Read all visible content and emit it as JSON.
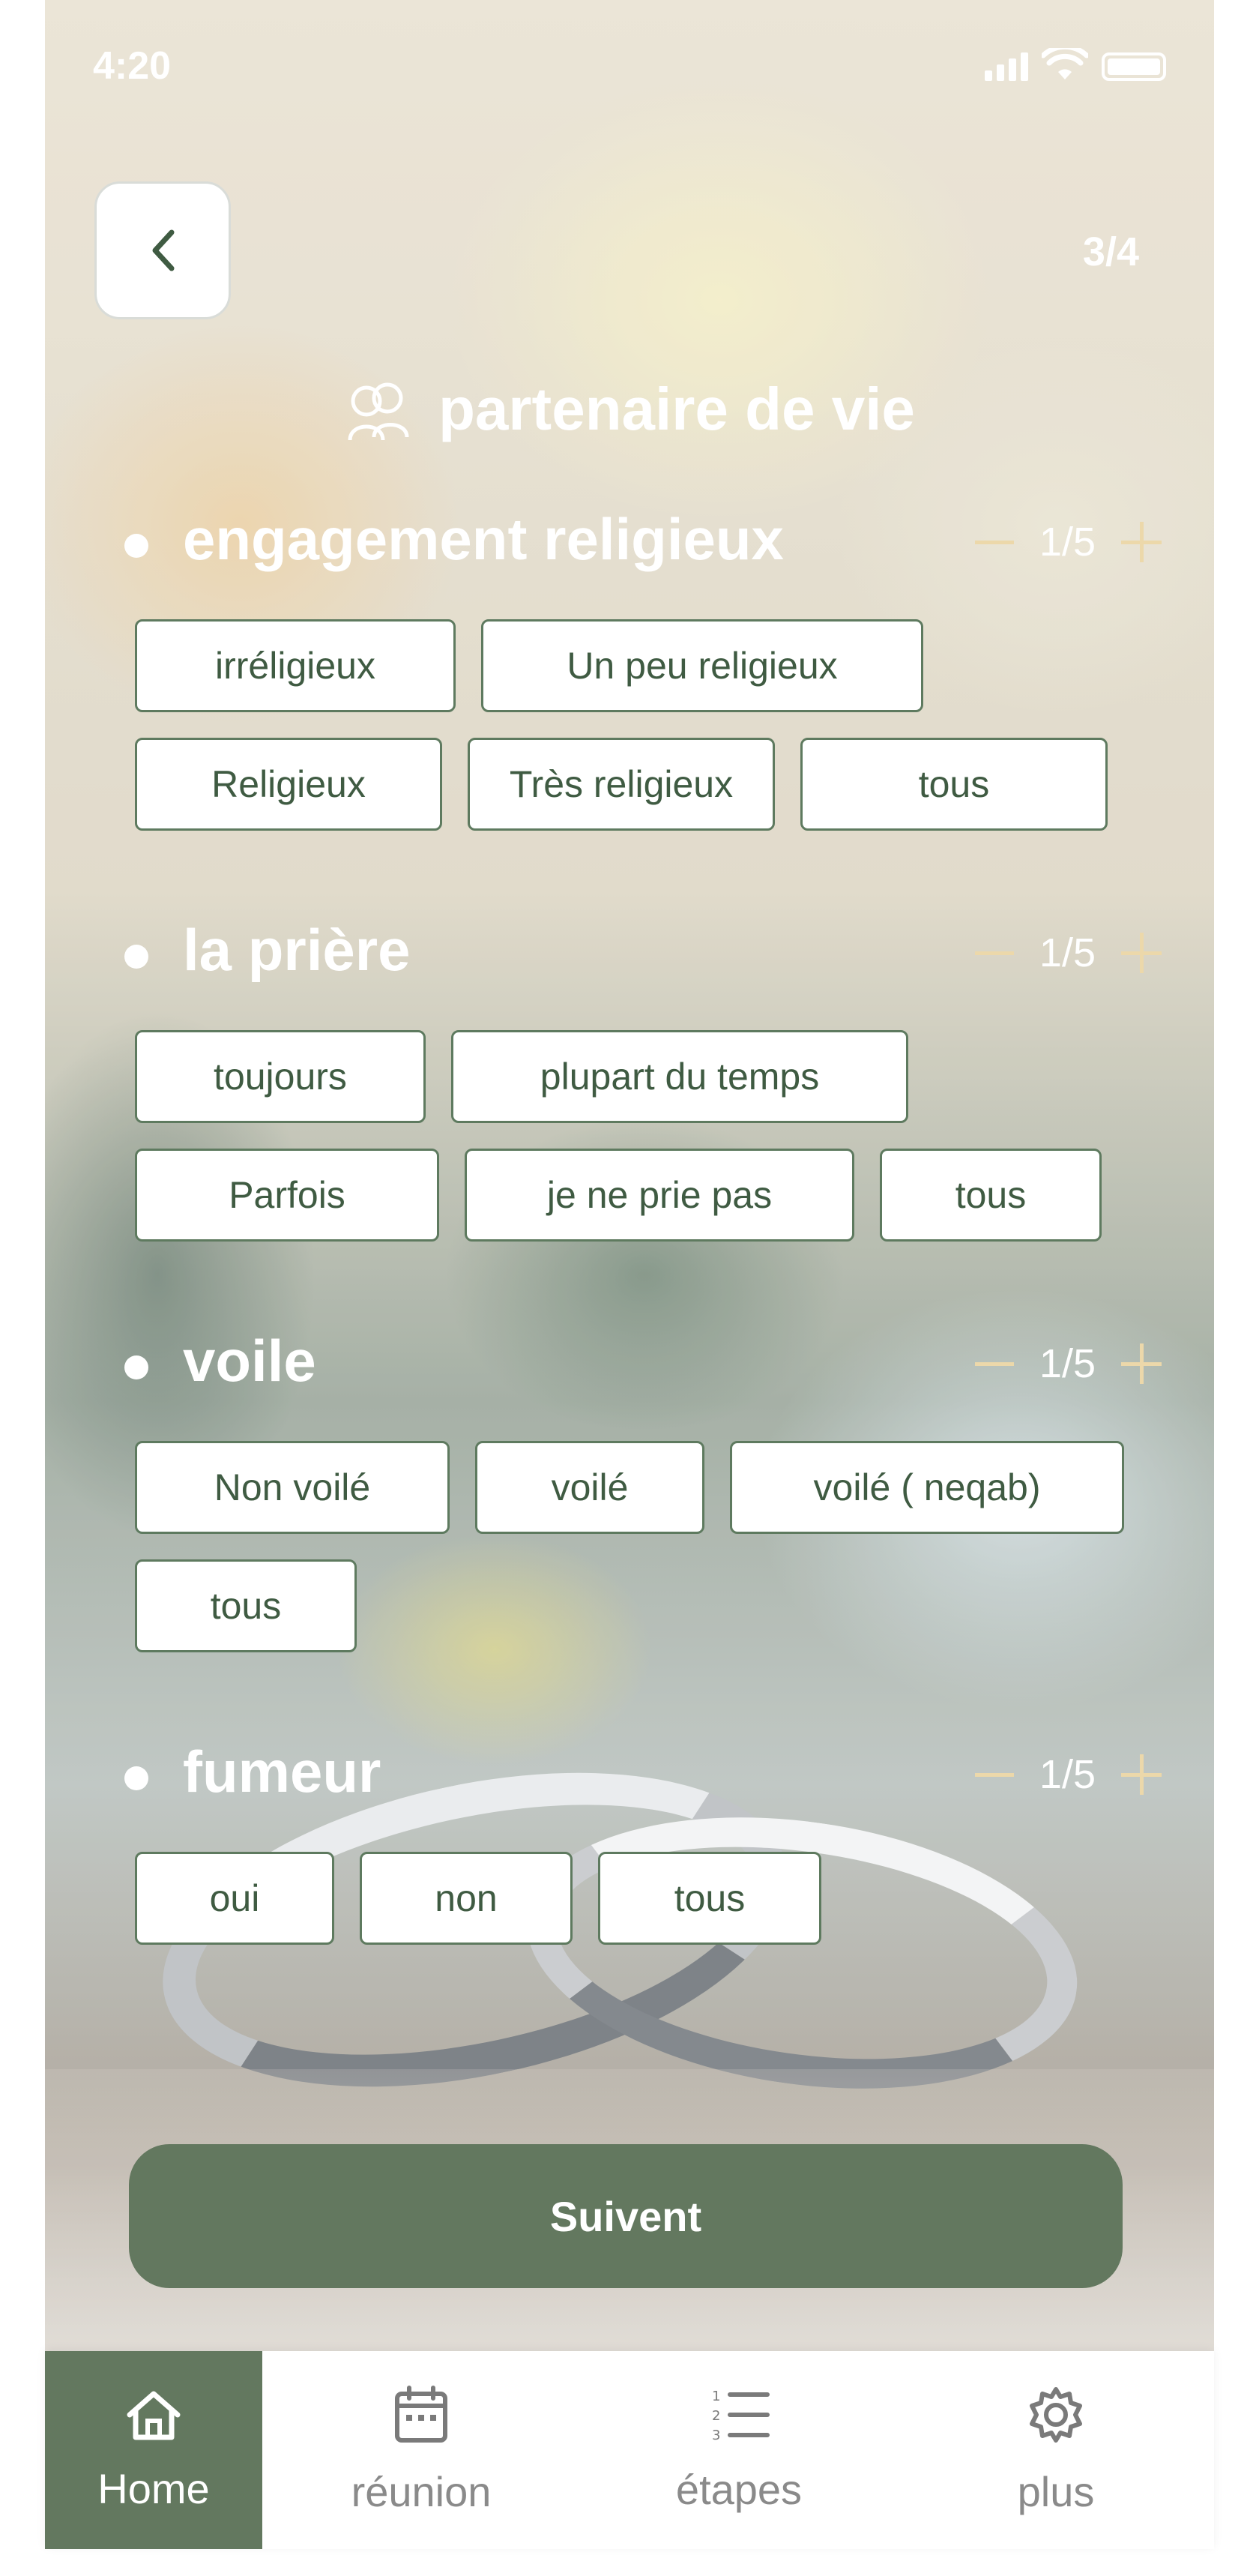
{
  "status_bar": {
    "time": "4:20"
  },
  "header": {
    "step": "3/4",
    "title": "partenaire de vie"
  },
  "sections": [
    {
      "title": "engagement religieux",
      "count": "1/5",
      "options": [
        "irréligieux",
        "Un peu religieux",
        "Religieux",
        "Très religieux",
        "tous"
      ]
    },
    {
      "title": "la prière",
      "count": "1/5",
      "options": [
        "toujours",
        "plupart du temps",
        "Parfois",
        "je ne prie pas",
        "tous"
      ]
    },
    {
      "title": "voile",
      "count": "1/5",
      "options": [
        "Non voilé",
        "voilé",
        "voilé ( neqab)",
        "tous"
      ]
    },
    {
      "title": "fumeur",
      "count": "1/5",
      "options": [
        "oui",
        "non",
        "tous"
      ]
    }
  ],
  "next_button": {
    "label": "Suivent"
  },
  "tabbar": {
    "items": [
      {
        "label": "Home",
        "icon": "home-icon",
        "active": true
      },
      {
        "label": "réunion",
        "icon": "calendar-icon",
        "active": false
      },
      {
        "label": "étapes",
        "icon": "numbered-list-icon",
        "active": false
      },
      {
        "label": "plus",
        "icon": "gear-icon",
        "active": false
      }
    ]
  },
  "colors": {
    "accent": "#63785f",
    "chip_border": "#5e7a5f",
    "counter_accent": "#ecd8aa"
  }
}
